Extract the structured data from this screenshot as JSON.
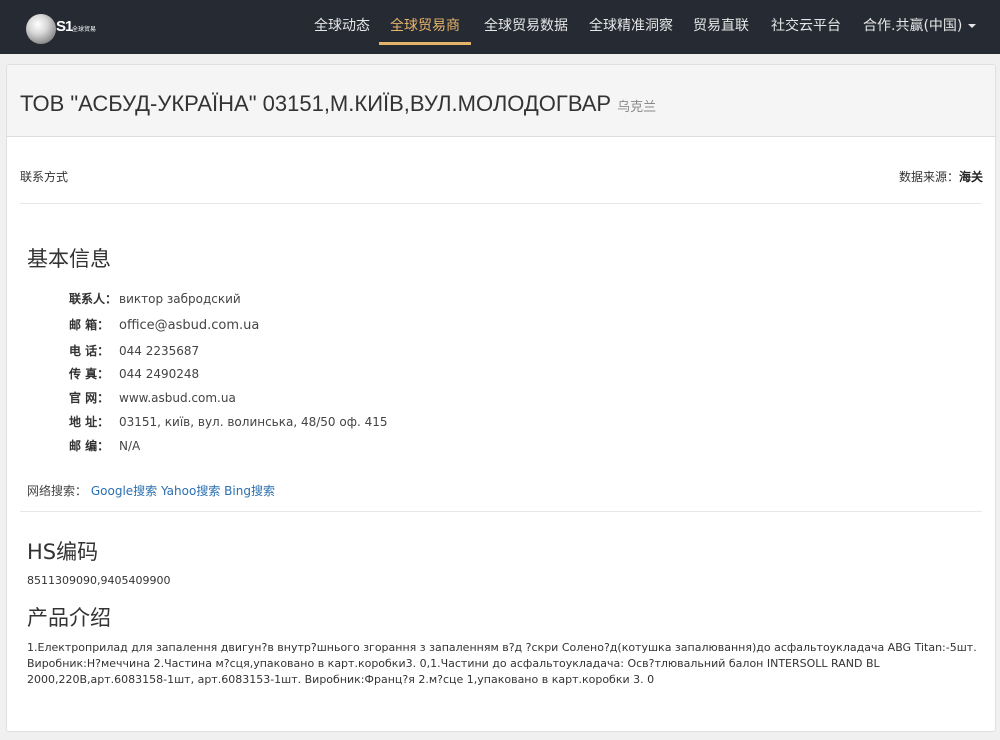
{
  "nav": {
    "logo_text": "S1",
    "logo_sub": "全球贸易",
    "items": [
      {
        "label": "全球动态"
      },
      {
        "label": "全球贸易商"
      },
      {
        "label": "全球贸易数据"
      },
      {
        "label": "全球精准洞察"
      },
      {
        "label": "贸易直联"
      },
      {
        "label": "社交云平台"
      },
      {
        "label": "合作.共赢(中国)"
      }
    ],
    "active_index": 1,
    "active_color": "#e6b36b"
  },
  "company": {
    "name": "ТОВ \"АСБУД-УКРАЇНА\" 03151,М.КИЇВ,ВУЛ.МОЛОДОГВАР",
    "country": "乌克兰"
  },
  "contact_section_label": "联系方式",
  "data_source": {
    "label": "数据来源：",
    "value": "海关"
  },
  "basic_info": {
    "heading": "基本信息",
    "fields": [
      {
        "label": "联系人：",
        "value": "виктор забродский"
      },
      {
        "label": "邮  箱：",
        "value": "office@asbud.com.ua"
      },
      {
        "label": "电  话：",
        "value": "044 2235687"
      },
      {
        "label": "传  真：",
        "value": "044 2490248"
      },
      {
        "label": "官  网：",
        "value": "www.asbud.com.ua"
      },
      {
        "label": "地  址：",
        "value": "03151, київ, вул. волинська, 48/50 оф. 415"
      },
      {
        "label": "邮  编：",
        "value": "N/A"
      }
    ]
  },
  "web_search": {
    "label": "网络搜索：",
    "links": [
      "Google搜索",
      "Yahoo搜索",
      "Bing搜索"
    ]
  },
  "hs": {
    "heading": "HS编码",
    "value": "8511309090,9405409900"
  },
  "product": {
    "heading": "产品介绍",
    "description": "1.Електроприлад для запалення двигун?в внутр?шнього згорання з запаленням в?д ?скри Солено?д(котушка запалювання)до асфальтоукладача ABG Titan:-5шт. Виробник:Н?меччина 2.Частина м?сця,упаковано в карт.коробки3. 0,1.Частини до асфальтоукладача: Осв?тлювальний балон INTERSOLL RAND BL 2000,220В,арт.6083158-1шт, арт.6083153-1шт. Виробник:Франц?я 2.м?сце 1,упаковано в карт.коробки 3. 0"
  }
}
